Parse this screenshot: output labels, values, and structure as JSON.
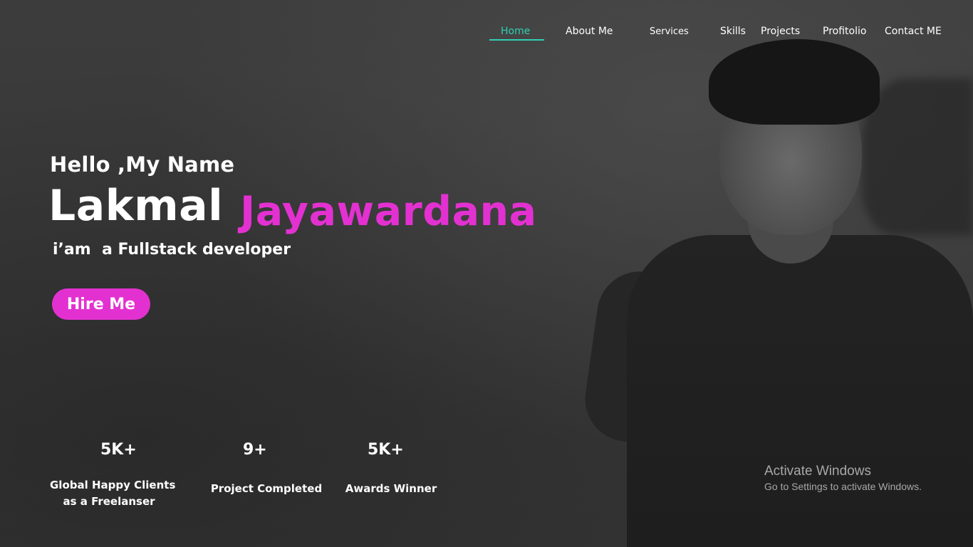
{
  "nav": {
    "items": [
      {
        "label": "Home",
        "active": true
      },
      {
        "label": "About Me"
      },
      {
        "label": "Services"
      },
      {
        "label": "Skills"
      },
      {
        "label": "Projects"
      },
      {
        "label": "Profitolio"
      },
      {
        "label": "Contact ME"
      }
    ]
  },
  "hero": {
    "greeting": "Hello ,My Name",
    "first_name": "Lakmal",
    "last_name": "Jayawardana",
    "role": "i’am  a Fullstack developer",
    "hire_button": "Hire Me"
  },
  "stats": [
    {
      "value": "5K+",
      "label_line1": "Global Happy Clients",
      "label_line2": "as a Freelanser"
    },
    {
      "value": "9+",
      "label_line1": "Project Completed"
    },
    {
      "value": "5K+",
      "label_line1": "Awards Winner"
    }
  ],
  "os_watermark": {
    "title": "Activate Windows",
    "subtitle": "Go to Settings to activate Windows."
  },
  "colors": {
    "accent_pink": "#e331d1",
    "accent_teal": "#2fd0b3",
    "background": "#3a3a3a"
  }
}
